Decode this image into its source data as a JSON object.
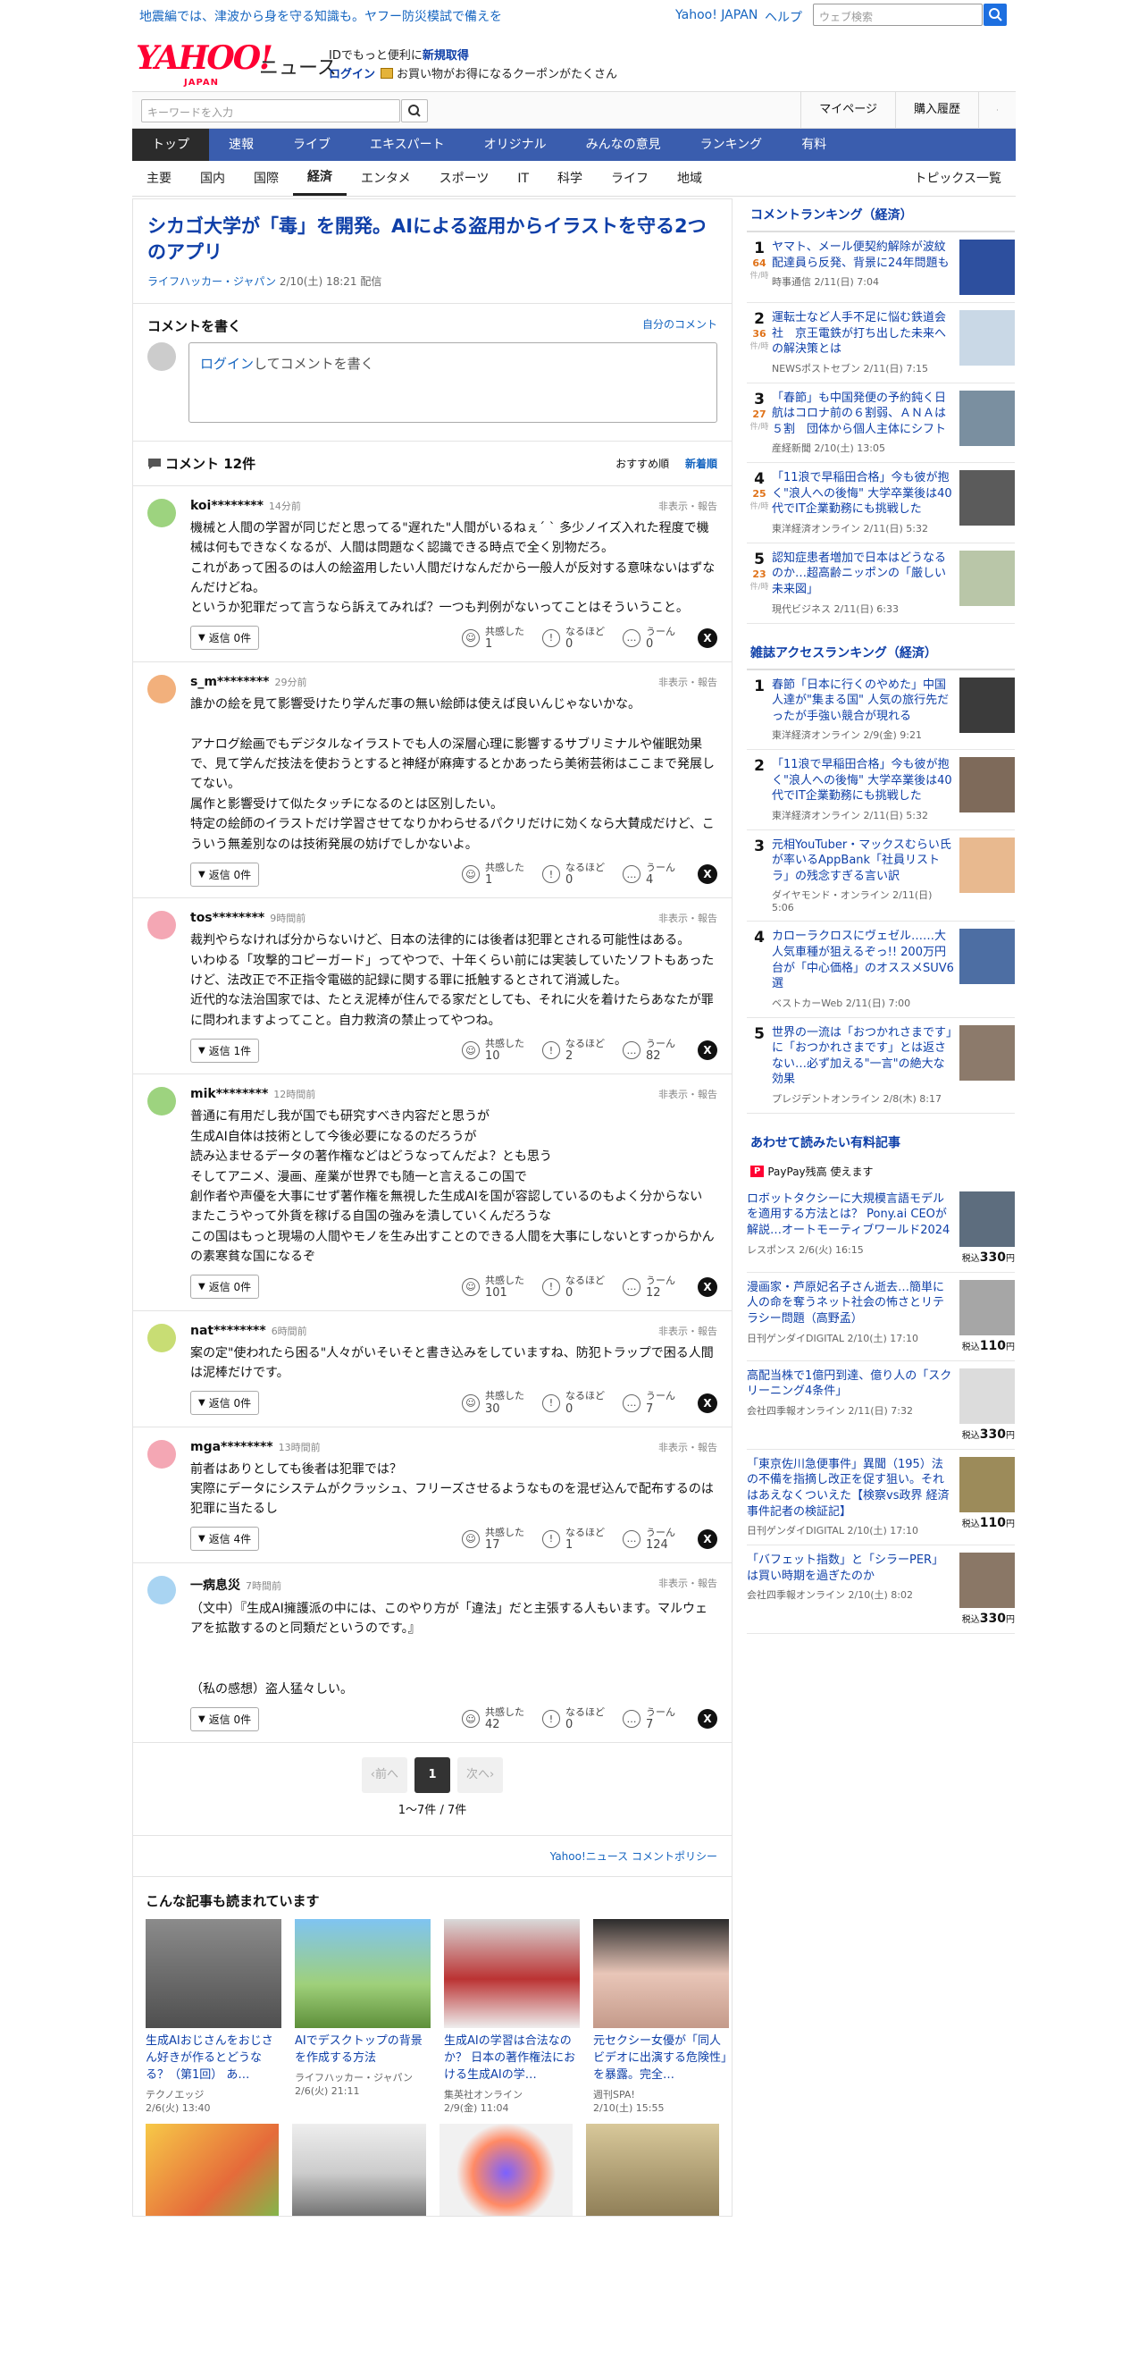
{
  "top": {
    "promo": "地震編では、津波から身を守る知識も。ヤフー防災模試で備えを",
    "yahoo_japan": "Yahoo! JAPAN",
    "help": "ヘルプ",
    "web_search_placeholder": "ウェブ検索"
  },
  "header": {
    "logo": "YAHOO!",
    "logo_sub": "JAPAN",
    "service": "ニュース",
    "id_text": "IDでもっと便利に",
    "id_link": "新規取得",
    "login": "ログイン",
    "coupon_text": "お買い物がお得になるクーポンがたくさん"
  },
  "search": {
    "placeholder": "キーワードを入力",
    "links": [
      "マイページ",
      "購入履歴"
    ]
  },
  "gnav": [
    "トップ",
    "速報",
    "ライブ",
    "エキスパート",
    "オリジナル",
    "みんなの意見",
    "ランキング",
    "有料"
  ],
  "cnav": [
    "主要",
    "国内",
    "国際",
    "経済",
    "エンタメ",
    "スポーツ",
    "IT",
    "科学",
    "ライフ",
    "地域"
  ],
  "cnav_topics": "トピックス一覧",
  "article": {
    "title": "シカゴ大学が「毒」を開発。AIによる盗用からイラストを守る2つのアプリ",
    "source": "ライフハッカー・ジャパン",
    "date": "2/10(土) 18:21 配信"
  },
  "write_comment": {
    "heading": "コメントを書く",
    "mine": "自分のコメント",
    "login": "ログイン",
    "prompt": "してコメントを書く"
  },
  "comments_header": {
    "title": "コメント 12件",
    "sort_recommended": "おすすめ順",
    "sort_new": "新着順"
  },
  "labels": {
    "report": "非表示・報告",
    "empathy": "共感した",
    "indeed": "なるほど",
    "hmm": "うーん",
    "x": "X"
  },
  "comments": [
    {
      "user": "koi********",
      "time": "14分前",
      "color": "#9dd37f",
      "body": "機械と人間の学習が同じだと思ってる\"遅れた\"人間がいるねぇ´ ` 多少ノイズ入れた程度で機械は何もできなくなるが、人間は問題なく認識できる時点で全く別物だろ。\nこれがあって困るのは人の絵盗用したい人間だけなんだから一般人が反対する意味ないはずなんだけどね。\nというか犯罪だって言うなら訴えてみれば？一つも判例がないってことはそういうこと。",
      "reply": "返信 0件",
      "empathy": "1",
      "indeed": "0",
      "hmm": "0"
    },
    {
      "user": "s_m********",
      "time": "29分前",
      "color": "#f2b07c",
      "body": "誰かの絵を見て影響受けたり学んだ事の無い絵師は使えば良いんじゃないかな。\n\nアナログ絵画でもデジタルなイラストでも人の深層心理に影響するサブリミナルや催眠効果で、見て学んだ技法を使おうとすると神経が麻痺するとかあったら美術芸術はここまで発展してない。\n属作と影響受けて似たタッチになるのとは区別したい。\n特定の絵師のイラストだけ学習させてなりかわらせるパクリだけに効くなら大賛成だけど、こういう無差別なのは技術発展の妨げでしかないよ。",
      "reply": "返信 0件",
      "empathy": "1",
      "indeed": "0",
      "hmm": "4"
    },
    {
      "user": "tos********",
      "time": "9時間前",
      "color": "#f4a7b4",
      "body": "裁判やらなければ分からないけど、日本の法律的には後者は犯罪とされる可能性はある。\nいわゆる「攻撃的コピーガード」ってやつで、十年くらい前には実装していたソフトもあったけど、法改正で不正指令電磁的記録に関する罪に抵触するとされて消滅した。\n近代的な法治国家では、たとえ泥棒が住んでる家だとしても、それに火を着けたらあなたが罪に問われますよってこと。自力救済の禁止ってやつね。",
      "reply": "返信 1件",
      "empathy": "10",
      "indeed": "2",
      "hmm": "82"
    },
    {
      "user": "mik********",
      "time": "12時間前",
      "color": "#9dd37f",
      "body": "普通に有用だし我が国でも研究すべき内容だと思うが\n生成AI自体は技術として今後必要になるのだろうが\n読み込ませるデータの著作権などはどうなってんだよ？とも思う\nそしてアニメ、漫画、産業が世界でも随一と言えるこの国で\n創作者や声優を大事にせず著作権を無視した生成AIを国が容認しているのもよく分からない\nまたこうやって外貨を稼げる自国の強みを潰していくんだろうな\nこの国はもっと現場の人間やモノを生み出すことのできる人間を大事にしないとすっからかんの素寒貧な国になるぞ",
      "reply": "返信 0件",
      "empathy": "101",
      "indeed": "0",
      "hmm": "12"
    },
    {
      "user": "nat********",
      "time": "6時間前",
      "color": "#c8dd74",
      "body": "案の定\"使われたら困る\"人々がいそいそと書き込みをしていますね、防犯トラップで困る人間は泥棒だけです。",
      "reply": "返信 0件",
      "empathy": "30",
      "indeed": "0",
      "hmm": "7"
    },
    {
      "user": "mga********",
      "time": "13時間前",
      "color": "#f4a7b4",
      "body": "前者はありとしても後者は犯罪では？\n実際にデータにシステムがクラッシュ、フリーズさせるようなものを混ぜ込んで配布するのは犯罪に当たるし",
      "reply": "返信 4件",
      "empathy": "17",
      "indeed": "1",
      "hmm": "124"
    },
    {
      "user": "一病息災",
      "time": "7時間前",
      "color": "#a9d4f2",
      "body": "（文中）『生成AI擁護派の中には、このやり方が「違法」だと主張する人もいます。マルウェアを拡散するのと同類だというのです。』\n\n\n（私の感想）盗人猛々しい。",
      "reply": "返信 0件",
      "empathy": "42",
      "indeed": "0",
      "hmm": "7"
    }
  ],
  "pager": {
    "prev": "前へ",
    "current": "1",
    "next": "次へ",
    "info": "1〜7件 / 7件"
  },
  "policy": "Yahoo!ニュース コメントポリシー",
  "recommended": {
    "heading": "こんな記事も読まれています",
    "items": [
      {
        "title": "生成AIおじさんをおじさん好きが作るとどうなる？（第1回） あ…",
        "source": "テクノエッジ",
        "date": "2/6(火) 13:40"
      },
      {
        "title": "AIでデスクトップの背景を作成する方法",
        "source": "ライフハッカー・ジャパン",
        "date": "2/6(火) 21:11"
      },
      {
        "title": "生成AIの学習は合法なのか？ 日本の著作権法における生成AIの学…",
        "source": "集英社オンライン",
        "date": "2/9(金) 11:04"
      },
      {
        "title": "元セクシー女優が「同人ビデオに出演する危険性」を暴露。完全…",
        "source": "週刊SPA!",
        "date": "2/10(土) 15:55"
      }
    ]
  },
  "side_ranking": {
    "heading": "コメントランキング（経済）",
    "unit": "件/時",
    "items": [
      {
        "no": "1",
        "count": "64",
        "title": "ヤマト、メール便契約解除が波紋　配達員ら反発、背景に24年問題も",
        "source": "時事通信 2/11(日) 7:04"
      },
      {
        "no": "2",
        "count": "36",
        "title": "運転士など人手不足に悩む鉄道会社　京王電鉄が打ち出した未来への解決策とは",
        "source": "NEWSポストセブン 2/11(日) 7:15"
      },
      {
        "no": "3",
        "count": "27",
        "title": "「春節」も中国発便の予約鈍く日航はコロナ前の６割弱、ＡＮＡは５割　団体から個人主体にシフト",
        "source": "産経新聞 2/10(土) 13:05"
      },
      {
        "no": "4",
        "count": "25",
        "title": "「11浪で早稲田合格」今も彼が抱く\"浪人への後悔\" 大学卒業後は40代でIT企業勤務にも挑戦した",
        "source": "東洋経済オンライン 2/11(日) 5:32"
      },
      {
        "no": "5",
        "count": "23",
        "title": "認知症患者増加で日本はどうなるのか…超高齢ニッポンの「厳しい未来図」",
        "source": "現代ビジネス 2/11(日) 6:33"
      }
    ]
  },
  "side_magazine": {
    "heading": "雑誌アクセスランキング（経済）",
    "items": [
      {
        "no": "1",
        "title": "春節「日本に行くのやめた」中国人達が\"集まる国\" 人気の旅行先だったが手強い競合が現れる",
        "source": "東洋経済オンライン 2/9(金) 9:21"
      },
      {
        "no": "2",
        "title": "「11浪で早稲田合格」今も彼が抱く\"浪人への後悔\" 大学卒業後は40代でIT企業勤務にも挑戦した",
        "source": "東洋経済オンライン 2/11(日) 5:32"
      },
      {
        "no": "3",
        "title": "元相YouTuber・マックスむらい氏が率いるAppBank「社員リストラ」の残念すぎる言い訳",
        "source": "ダイヤモンド・オンライン 2/11(日) 5:06"
      },
      {
        "no": "4",
        "title": "カローラクロスにヴェゼル……大人気車種が狙えるぞっ!! 200万円台が「中心価格」のオススメSUV6選",
        "source": "ベストカーWeb 2/11(日) 7:00"
      },
      {
        "no": "5",
        "title": "世界の一流は「おつかれさまです」に「おつかれさまです」とは返さない…必ず加える\"一言\"の絶大な効果",
        "source": "プレジデントオンライン 2/8(木) 8:17"
      }
    ]
  },
  "side_paid": {
    "heading": "あわせて読みたい有料記事",
    "paypay": "PayPay残高 使えます",
    "tax": "税込",
    "items": [
      {
        "title": "ロボットタクシーに大規模言語モデルを適用する方法とは？ Pony.ai CEOが解説…オートモーティブワールド2024",
        "source": "レスポンス 2/6(火) 16:15",
        "price": "330",
        "unit": "円"
      },
      {
        "title": "漫画家・芦原妃名子さん逝去…簡単に人の命を奪うネット社会の怖さとリテラシー問題（高野孟）",
        "source": "日刊ゲンダイDIGITAL 2/10(土) 17:10",
        "price": "110",
        "unit": "円"
      },
      {
        "title": "高配当株で1億円到達、億り人の「スクリーニング4条件」",
        "source": "会社四季報オンライン 2/11(日) 7:32",
        "price": "330",
        "unit": "円"
      },
      {
        "title": "「東京佐川急便事件」異聞（195）法の不備を指摘し改正を促す狙い。それはあえなくついえた【検察vs政界 経済事件記者の検証記】",
        "source": "日刊ゲンダイDIGITAL 2/10(土) 17:10",
        "price": "110",
        "unit": "円"
      },
      {
        "title": "「バフェット指数」と「シラーPER」は買い時期を過ぎたのか",
        "source": "会社四季報オンライン 2/10(土) 8:02",
        "price": "330",
        "unit": "円"
      }
    ]
  }
}
